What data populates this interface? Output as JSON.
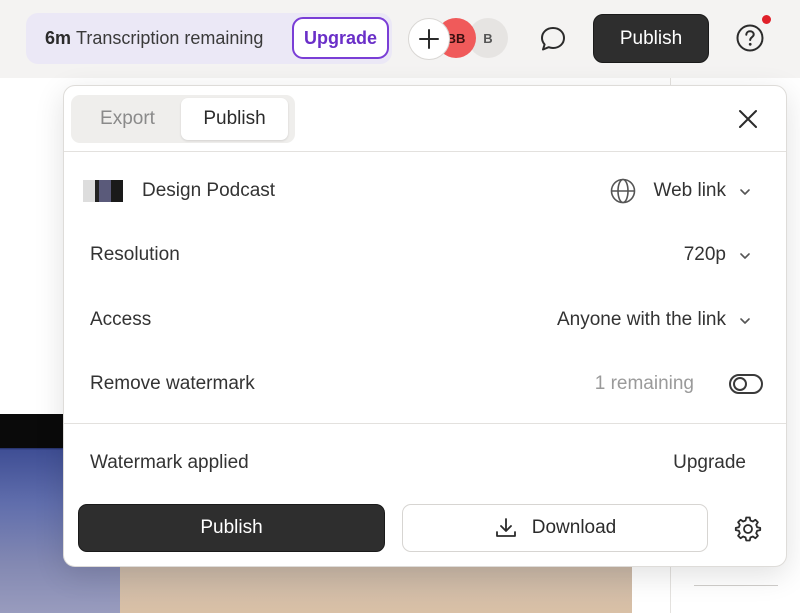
{
  "topbar": {
    "transcription_minutes": "6m",
    "transcription_text": "Transcription remaining",
    "upgrade_label": "Upgrade",
    "avatars": [
      "BB",
      "B"
    ],
    "publish_label": "Publish"
  },
  "modal": {
    "tabs": [
      {
        "label": "Export",
        "active": false
      },
      {
        "label": "Publish",
        "active": true
      }
    ],
    "project": {
      "name": "Design Podcast",
      "destination": "Web link"
    },
    "resolution": {
      "label": "Resolution",
      "value": "720p"
    },
    "access": {
      "label": "Access",
      "value": "Anyone with the link"
    },
    "watermark": {
      "label": "Remove watermark",
      "remaining": "1 remaining",
      "enabled": false
    },
    "watermark_applied": {
      "label": "Watermark applied",
      "action": "Upgrade"
    },
    "publish_label": "Publish",
    "download_label": "Download"
  },
  "colors": {
    "accent": "#7a3ed6",
    "dark_button": "#2e2e2e",
    "notification": "#e0202a",
    "avatar_bb": "#f05a5a"
  },
  "icons": [
    "plus-icon",
    "comment-icon",
    "help-icon",
    "close-icon",
    "globe-icon",
    "chevron-down-icon",
    "download-icon",
    "gear-icon"
  ]
}
